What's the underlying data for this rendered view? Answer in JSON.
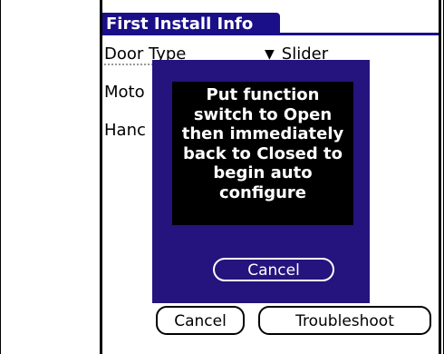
{
  "title": "First Install Info",
  "fields": {
    "door_type_label": "Door Type",
    "door_type_value": "Slider",
    "door_type_arrow": "▼",
    "row2_partial_label": "Moto",
    "row3_partial_label": "Hanc"
  },
  "dialog": {
    "message": "Put function\nswitch to Open\nthen immediately\nback to Closed to\nbegin auto\nconfigure",
    "cancel_label": "Cancel"
  },
  "buttons": {
    "cancel_label": "Cancel",
    "troubleshoot_label": "Troubleshoot"
  },
  "colors": {
    "accent": "#1a0f88",
    "dialog_bg": "#25137e",
    "message_bg": "#000000"
  }
}
